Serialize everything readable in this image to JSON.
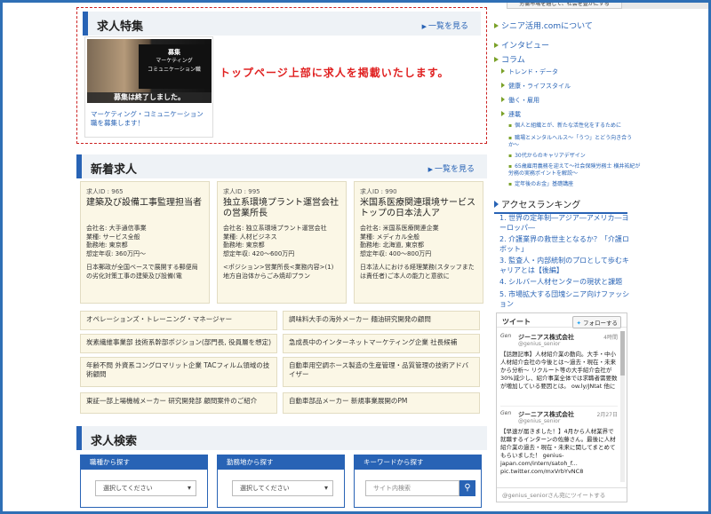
{
  "header": {
    "strip_text": "労働市場を通して、社会を豊かにする"
  },
  "feature": {
    "title": "求人特集",
    "more": "一覧を見る",
    "board_title": "募集",
    "board_sub1": "マーケティング",
    "board_sub2": "コミュニケーション職",
    "ended": "募集は終了しました。",
    "caption": "マーケティング・コミュニケーション職を募集します！",
    "promo": "トップページ上部に求人を掲載いたします。"
  },
  "new_jobs": {
    "title": "新着求人",
    "more": "一覧を見る",
    "cards": [
      {
        "id": "求人ID : 965",
        "title": "建築及び設備工事監理担当者",
        "company": "会社名: 大手通信事業",
        "industry": "業種: サービス全般",
        "location": "勤務地: 東京都",
        "salary": "想定年収: 360万円〜",
        "desc": "日本郵政が全国ベースで展開する郵便局の劣化対策工事の建築及び設備(電"
      },
      {
        "id": "求人ID : 995",
        "title": "独立系環境プラント運営会社の営業所長",
        "company": "会社名: 独立系環境プラント運営会社",
        "industry": "業種: 人材ビジネス",
        "location": "勤務地: 東京都",
        "salary": "想定年収: 420〜600万円",
        "desc": "<ポジション>営業所長<業務内容>(1) 地方自治体からごみ焼却プラン"
      },
      {
        "id": "求人ID : 990",
        "title": "米国系医療関連環境サービストップの日本法人ア",
        "company": "会社名: 米国系医療関連企業",
        "industry": "業種: メディカル全般",
        "location": "勤務地: 北海道, 東京都",
        "salary": "想定年収: 400〜800万円",
        "desc": "日本法人における経理業務(スタッフまたは責任者)ご本人の能力と意欲に"
      }
    ],
    "list": [
      "オペレーションズ・トレーニング・マネージャー",
      "調味料大手の海外メーカー 麺油研究開発の顧問",
      "炭素繊維事業部 技術系幹部ポジション(部門長, 役員層を想定)",
      "急成長中のインターネットマーケティング企業 社長候補",
      "年齢不問 外資系コングロマリット企業 TACフィルム領域の技術顧問",
      "自動車用空調ホース製造の生産管理・品質管理の技術アドバイザー",
      "東証一部上場機械メーカー 研究開発部 顧問案件のご紹介",
      "自動車部品メーカー 新規事業展開のPM"
    ]
  },
  "search": {
    "title": "求人検索",
    "boxes": [
      {
        "label": "職種から探す",
        "value": "選択してください"
      },
      {
        "label": "勤務地から探す",
        "value": "選択してください"
      },
      {
        "label": "キーワードから探す",
        "placeholder": "サイト内検索"
      }
    ]
  },
  "sidebar": {
    "about": "シニア活用.comについて",
    "interview": "インタビュー",
    "column": "コラム",
    "sub": [
      "トレンド・データ",
      "健康・ライフスタイル",
      "働く・雇用",
      "連載"
    ],
    "articles": [
      "個人と組織とが、新たな活性化をするために",
      "職場とメンタルヘルス〜「うつ」とどう向き合うか〜",
      "30代からのキャリアデザイン",
      "65歳雇用義務を迎えて〜社会保険労務士 横井祐紀が労務の実務ポイントを解説〜",
      "定年後のお金」基礎講座"
    ],
    "ranking_title": "アクセスランキング",
    "ranking": [
      "1. 世界の定年制―アジア―アメリカ―ヨーロッパ―",
      "2. 介護業界の救世主となるか？「介護ロボット」",
      "3. 監査人・内部統制のプロとして歩むキャリアとは【後編】",
      "4. シルバー人材センターの現状と課題",
      "5. 市場拡大する団塊シニア向けファッション"
    ]
  },
  "tweets": {
    "title": "ツイート",
    "follow": "フォローする",
    "items": [
      {
        "name": "ジーニアス株式会社",
        "handle": "@genius_senior",
        "date": "4時間",
        "body": "【話題記事】人材紹介業の動向。大手・中小人材紹介会社の今後とは〜過去・現在・未来から分析〜 リクルート等の大手紹介会社が30%減少し、紹介事業全体では求職者需要数が増加している要因とは。 ow.ly/JNtat 他に"
      },
      {
        "name": "ジーニアス株式会社",
        "handle": "@genius_senior",
        "date": "2月27日",
        "body": "【早速が届きました！】4月から人材業界で就職するインターンの佐藤さん。最後に人材紹介業の過去・現在・未来に関してまとめてもらいました！ genius-japan.com/intern/satoh_f... pic.twitter.com/mxVrbYvNC8"
      }
    ],
    "footer": "@genius_seniorさん宛にツイートする"
  }
}
